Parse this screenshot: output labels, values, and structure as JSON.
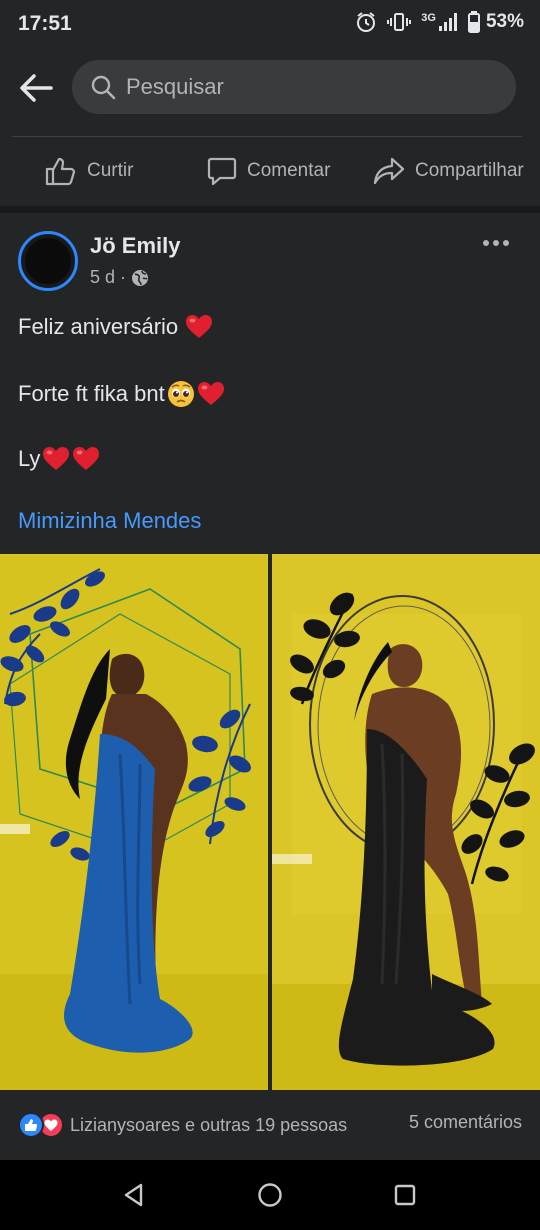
{
  "status_bar": {
    "time": "17:51",
    "network": "3G",
    "battery": "53%"
  },
  "search": {
    "placeholder": "Pesquisar"
  },
  "actions": {
    "like": "Curtir",
    "comment": "Comentar",
    "share": "Compartilhar"
  },
  "post": {
    "author": "Jö Emily",
    "time_ago": "5 d",
    "separator": "·",
    "lines": [
      "Feliz aniversário",
      "Forte ft fika bnt",
      "Ly"
    ],
    "tagged": "Mimizinha Mendes",
    "photos": [
      {
        "drape_color": "#1d5fae",
        "leaf_color": "#1a3a8a"
      },
      {
        "drape_color": "#1b1b1b",
        "leaf_color": "#141414"
      }
    ],
    "reactions_text": "Lizianysoares e outras 19 pessoas",
    "comments": "5 comentários"
  },
  "colors": {
    "background": "#18191a",
    "surface": "#242526",
    "accent": "#2d88ff",
    "link": "#4599ff",
    "love": "#f33e58",
    "photo_backdrop": "#d9c621"
  },
  "icons": {
    "back": "arrow-left-icon",
    "search": "search-icon",
    "like": "thumbs-up-icon",
    "comment": "speech-bubble-icon",
    "share": "share-arrow-icon",
    "privacy": "globe-icon",
    "more": "more-dots-icon"
  }
}
